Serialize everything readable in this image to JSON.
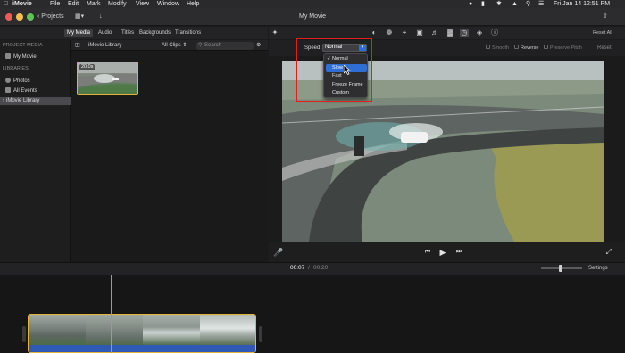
{
  "menubar": {
    "app": "iMovie",
    "items": [
      "File",
      "Edit",
      "Mark",
      "Modify",
      "View",
      "Window",
      "Help"
    ],
    "clock": "Fri Jan 14  12:51 PM"
  },
  "titlebar": {
    "back_label": "Projects",
    "title": "My Movie"
  },
  "browser_tabs": [
    "My Media",
    "Audio",
    "Titles",
    "Backgrounds",
    "Transitions"
  ],
  "sidebar": {
    "project_media_heading": "PROJECT MEDIA",
    "project_items": [
      {
        "label": "My Movie",
        "icon": "film-icon"
      }
    ],
    "libraries_heading": "LIBRARIES",
    "library_items": [
      {
        "label": "Photos",
        "icon": "photos-icon"
      },
      {
        "label": "All Events",
        "icon": "events-icon"
      },
      {
        "label": "iMovie Library",
        "icon": "library-icon",
        "selected": true
      }
    ]
  },
  "browser": {
    "library_name": "iMovie Library",
    "filter": "All Clips",
    "search_placeholder": "Search",
    "clip_badge": "20.0s"
  },
  "viewer_tools": [
    "magic-wand-icon",
    "color-balance-icon",
    "color-correction-icon",
    "crop-icon",
    "stabilization-icon",
    "volume-icon",
    "noise-reduction-icon",
    "speed-icon",
    "video-overlay-icon",
    "clip-filter-icon",
    "info-icon"
  ],
  "reset_all": "Reset All",
  "speed": {
    "label": "Speed:",
    "selected": "Normal",
    "options": [
      "Normal",
      "Slow",
      "Fast",
      "Freeze Frame",
      "Custom"
    ],
    "highlighted": "Slow",
    "checked": "Normal",
    "smooth_label": "Smooth",
    "reverse_label": "Reverse",
    "preserve_pitch_label": "Preserve Pitch",
    "reset_label": "Reset"
  },
  "timeline": {
    "current_time": "00:07",
    "separator": "/",
    "total_time": "00:20",
    "settings_label": "Settings"
  },
  "colors": {
    "accent": "#2f6fd5",
    "clip_border": "#e2b53a",
    "highlight_box": "#e0201c",
    "audio_track": "#2e59b4"
  }
}
